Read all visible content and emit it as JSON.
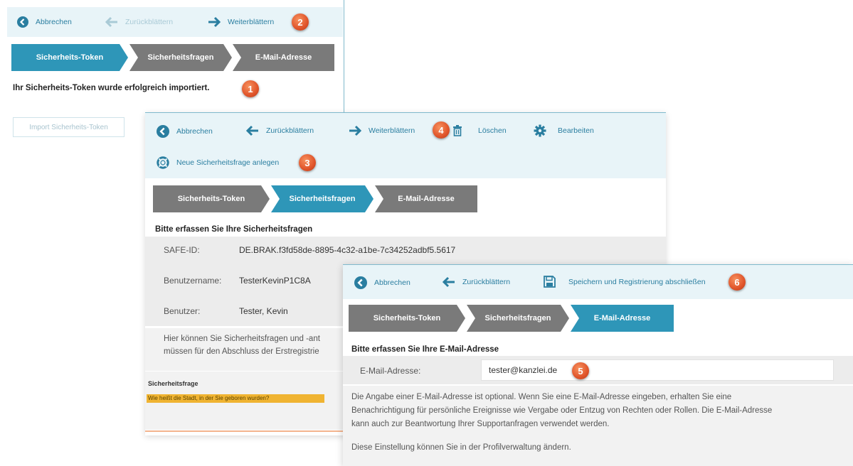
{
  "panel1": {
    "toolbar": {
      "cancel": "Abbrechen",
      "back": "Zurückblättern",
      "forward": "Weiterblättern"
    },
    "steps": [
      "Sicherheits-Token",
      "Sicherheitsfragen",
      "E-Mail-Adresse"
    ],
    "message": "Ihr Sicherheits-Token wurde erfolgreich importiert.",
    "import_button": "Import Sicherheits-Token",
    "badges": [
      "2",
      "1"
    ]
  },
  "panel2": {
    "toolbar": {
      "cancel": "Abbrechen",
      "back": "Zurückblättern",
      "forward": "Weiterblättern",
      "delete": "Löschen",
      "edit": "Bearbeiten",
      "new_question": "Neue Sicherheitsfrage anlegen"
    },
    "steps": [
      "Sicherheits-Token",
      "Sicherheitsfragen",
      "E-Mail-Adresse"
    ],
    "heading": "Bitte erfassen Sie Ihre Sicherheitsfragen",
    "fields": [
      {
        "label": "SAFE-ID:",
        "value": "DE.BRAK.f3fd58de-8895-4c32-a1be-7c34252adbf5.5617"
      },
      {
        "label": "Benutzername:",
        "value": "TesterKevinP1C8A"
      },
      {
        "label": "Benutzer:",
        "value": "Tester, Kevin"
      }
    ],
    "info_line1": "Hier können Sie Sicherheitsfragen und -ant",
    "info_line2": "müssen für den Abschluss der Erstregistrie",
    "question_label": "Sicherheitsfrage",
    "question_value": "Wie heißt die Stadt, in der Sie geboren wurden?",
    "badges": [
      "4",
      "3"
    ]
  },
  "panel3": {
    "toolbar": {
      "cancel": "Abbrechen",
      "back": "Zurückblättern",
      "save": "Speichern und Registrierung abschließen"
    },
    "steps": [
      "Sicherheits-Token",
      "Sicherheitsfragen",
      "E-Mail-Adresse"
    ],
    "heading": "Bitte erfassen Sie Ihre E-Mail-Adresse",
    "email_label": "E-Mail-Adresse:",
    "email_value": "tester@kanzlei.de",
    "info_line1": "Die Angabe einer E-Mail-Adresse ist optional. Wenn Sie eine E-Mail-Adresse eingeben, erhalten Sie eine",
    "info_line2": "Benachrichtigung für persönliche Ereignisse wie Vergabe oder Entzug von Rechten oder Rollen. Die E-Mail-Adresse",
    "info_line3": "kann auch zur Beantwortung Ihrer Supportanfragen verwendet werden.",
    "info_line4": "Diese Einstellung können Sie in der Profilverwaltung ändern.",
    "badges": [
      "6",
      "5"
    ]
  },
  "colors": {
    "accent": "#2e96b8",
    "step_gray": "#7a7a7a",
    "toolbar_bg": "#e8f4f8",
    "badge": "#e0542a",
    "highlight": "#f0b432"
  }
}
